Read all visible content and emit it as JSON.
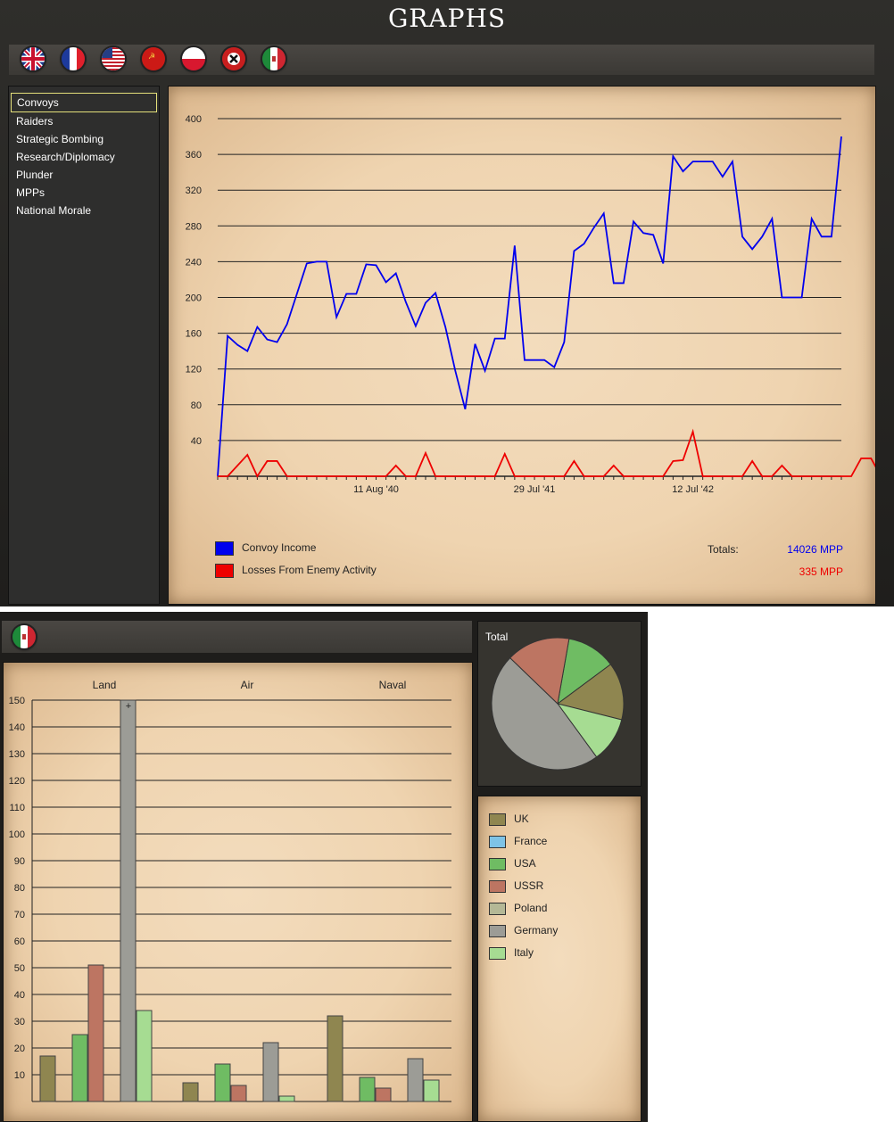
{
  "window": {
    "title": "GRAPHS"
  },
  "flags": [
    {
      "icon": "uk-flag-icon"
    },
    {
      "icon": "france-flag-icon"
    },
    {
      "icon": "usa-flag-icon"
    },
    {
      "icon": "ussr-flag-icon"
    },
    {
      "icon": "poland-flag-icon"
    },
    {
      "icon": "germany-flag-icon"
    },
    {
      "icon": "italy-flag-icon"
    }
  ],
  "sidebar": {
    "items": [
      {
        "label": "Convoys"
      },
      {
        "label": "Raiders"
      },
      {
        "label": "Strategic Bombing"
      },
      {
        "label": "Research/Diplomacy"
      },
      {
        "label": "Plunder"
      },
      {
        "label": "MPPs"
      },
      {
        "label": "National Morale"
      }
    ]
  },
  "legend": {
    "items": [
      {
        "label": "Convoy Income",
        "color": "#0000ee"
      },
      {
        "label": "Losses From Enemy Activity",
        "color": "#ee0000"
      }
    ],
    "totals_label": "Totals:",
    "totals": [
      "14026 MPP",
      "335 MPP"
    ]
  },
  "chart_data": [
    {
      "type": "line",
      "title": "",
      "ylim": [
        0,
        400
      ],
      "yticks": [
        40,
        80,
        120,
        160,
        200,
        240,
        280,
        320,
        360,
        400
      ],
      "xtick_labels": [
        {
          "label": "11 Aug '40",
          "index": 16
        },
        {
          "label": "29 Jul '41",
          "index": 32
        },
        {
          "label": "12 Jul '42",
          "index": 48
        }
      ],
      "series": [
        {
          "name": "Convoy Income",
          "color": "#0000ee",
          "values": [
            0,
            157,
            147,
            140,
            167,
            153,
            150,
            170,
            204,
            238,
            240,
            240,
            178,
            204,
            204,
            237,
            236,
            217,
            227,
            195,
            168,
            194,
            205,
            167,
            118,
            75,
            148,
            118,
            154,
            154,
            258,
            130,
            130,
            130,
            122,
            150,
            252,
            260,
            278,
            294,
            216,
            216,
            285,
            272,
            270,
            238,
            358,
            341,
            352,
            352,
            352,
            335,
            352,
            268,
            254,
            268,
            288,
            200,
            200,
            200,
            288,
            268,
            268,
            380
          ]
        },
        {
          "name": "Losses From Enemy Activity",
          "color": "#ee0000",
          "values": [
            0,
            0,
            12,
            24,
            0,
            17,
            17,
            0,
            0,
            0,
            0,
            0,
            0,
            0,
            0,
            0,
            0,
            0,
            12,
            0,
            0,
            26,
            0,
            0,
            0,
            0,
            0,
            0,
            0,
            25,
            0,
            0,
            0,
            0,
            0,
            0,
            17,
            0,
            0,
            0,
            12,
            0,
            0,
            0,
            0,
            0,
            17,
            18,
            50,
            0,
            0,
            0,
            0,
            0,
            17,
            0,
            0,
            12,
            0,
            0,
            0,
            0,
            0,
            0,
            0,
            20,
            20,
            0
          ]
        }
      ]
    },
    {
      "type": "bar",
      "title": "",
      "groups": [
        "Land",
        "Air",
        "Naval"
      ],
      "ylim": [
        0,
        150
      ],
      "yticks": [
        10,
        20,
        30,
        40,
        50,
        60,
        70,
        80,
        90,
        100,
        110,
        120,
        130,
        140,
        150
      ],
      "series": [
        {
          "name": "UK",
          "color": "#8f8650",
          "values": [
            17,
            7,
            32
          ]
        },
        {
          "name": "France",
          "color": "#7ec3e6",
          "values": [
            0,
            0,
            0
          ]
        },
        {
          "name": "USA",
          "color": "#6fbc63",
          "values": [
            25,
            14,
            9
          ]
        },
        {
          "name": "USSR",
          "color": "#bd7562",
          "values": [
            51,
            6,
            5
          ]
        },
        {
          "name": "Poland",
          "color": "#b4b896",
          "values": [
            0,
            0,
            0
          ]
        },
        {
          "name": "Germany",
          "color": "#9c9c96",
          "values": [
            150,
            22,
            16
          ]
        },
        {
          "name": "Italy",
          "color": "#a6dc92",
          "values": [
            34,
            2,
            8
          ]
        }
      ]
    },
    {
      "type": "pie",
      "title": "Total",
      "slices": [
        {
          "name": "UK",
          "color": "#8f8650",
          "value": 56
        },
        {
          "name": "France",
          "color": "#7ec3e6",
          "value": 0
        },
        {
          "name": "USA",
          "color": "#6fbc63",
          "value": 48
        },
        {
          "name": "USSR",
          "color": "#bd7562",
          "value": 62
        },
        {
          "name": "Poland",
          "color": "#b4b896",
          "value": 0
        },
        {
          "name": "Germany",
          "color": "#9c9c96",
          "value": 188
        },
        {
          "name": "Italy",
          "color": "#a6dc92",
          "value": 44
        }
      ]
    }
  ],
  "panel2": {
    "flag_icon": "italy-flag-icon",
    "pie_title": "Total",
    "overflow_mark": "+"
  }
}
